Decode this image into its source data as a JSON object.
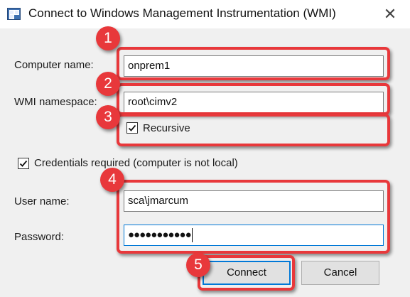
{
  "window": {
    "title": "Connect to Windows Management Instrumentation (WMI)",
    "close_glyph": "✕"
  },
  "form": {
    "computer_name_label": "Computer name:",
    "computer_name_value": "onprem1",
    "namespace_label": "WMI namespace:",
    "namespace_value": "root\\cimv2",
    "recursive_label": "Recursive",
    "recursive_checked": true,
    "credentials_label": "Credentials required (computer is not local)",
    "credentials_checked": true,
    "username_label": "User name:",
    "username_value": "sca\\jmarcum",
    "password_label": "Password:",
    "password_value": "●●●●●●●●●●●"
  },
  "buttons": {
    "connect_label": "Connect",
    "cancel_label": "Cancel"
  },
  "callouts": [
    "1",
    "2",
    "3",
    "4",
    "5"
  ],
  "colors": {
    "callout": "#e8383b",
    "focus": "#0078d7",
    "dialog_bg": "#f0f0f0"
  }
}
